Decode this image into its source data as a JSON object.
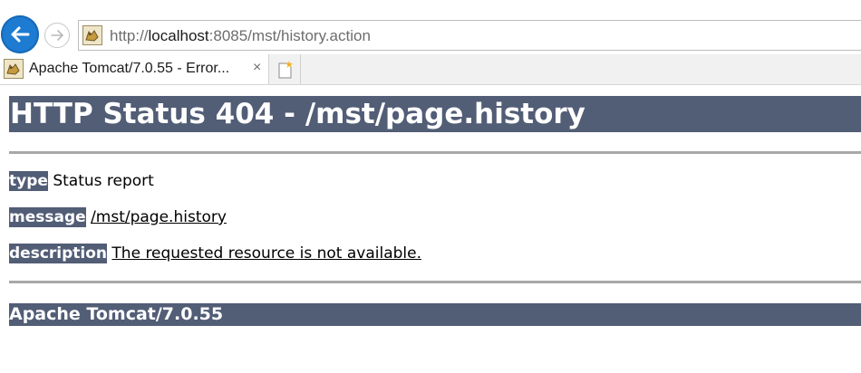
{
  "browser": {
    "address": {
      "prefix": "http://",
      "host": "localhost",
      "rest": ":8085/mst/history.action"
    },
    "tab": {
      "title": "Apache Tomcat/7.0.55 - Error...",
      "close": "×"
    }
  },
  "page": {
    "heading": "HTTP Status 404 - /mst/page.history",
    "rows": [
      {
        "label": "type",
        "value": "Status report"
      },
      {
        "label": "message",
        "value": "/mst/page.history"
      },
      {
        "label": "description",
        "value": "The requested resource is not available."
      }
    ],
    "footer": "Apache Tomcat/7.0.55"
  },
  "icons": {
    "back": "back-arrow-icon",
    "forward": "forward-arrow-icon",
    "favicon": "tomcat-favicon-icon",
    "new_tab": "new-tab-icon"
  },
  "colors": {
    "tomcat_header_bg": "#525d76",
    "back_button": "#1d7bd1"
  }
}
